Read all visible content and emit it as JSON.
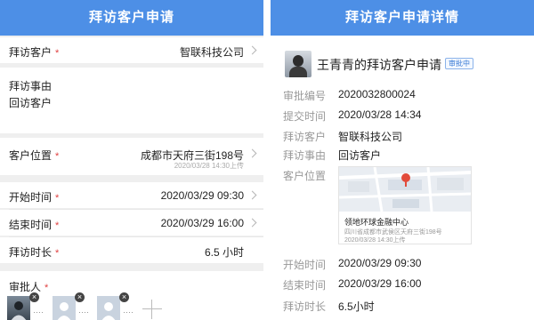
{
  "left": {
    "title": "拜访客户申请",
    "customer": {
      "label": "拜访客户",
      "value": "智联科技公司"
    },
    "matter": {
      "label": "拜访事由",
      "value": "回访客户"
    },
    "location": {
      "label": "客户位置",
      "value": "成都市天府三街198号",
      "sub": "2020/03/28 14:30上传"
    },
    "start": {
      "label": "开始时间",
      "value": "2020/03/29 09:30"
    },
    "end": {
      "label": "结束时间",
      "value": "2020/03/29 16:00"
    },
    "duration": {
      "label": "拜访时长",
      "value": "6.5 小时"
    },
    "approvers_label": "审批人",
    "required_mark": "*",
    "close_mark": "×",
    "dots": "····"
  },
  "right": {
    "title": "拜访客户申请详情",
    "request_title": "王青青的拜访客户申请",
    "badge": "审批中",
    "fields": [
      {
        "label": "审批编号",
        "value": "2020032800024"
      },
      {
        "label": "提交时间",
        "value": "2020/03/28 14:34"
      },
      {
        "label": "拜访客户",
        "value": "智联科技公司"
      },
      {
        "label": "拜访事由",
        "value": "回访客户"
      },
      {
        "label": "客户位置",
        "value": ""
      },
      {
        "label": "开始时间",
        "value": "2020/03/29 09:30"
      },
      {
        "label": "结束时间",
        "value": "2020/03/29 16:00"
      },
      {
        "label": "拜访时长",
        "value": "6.5小时"
      }
    ],
    "map": {
      "place": "领地环球金融中心",
      "address": "四川省成都市武侯区天府三街198号",
      "time": "2020/03/28 14:30上传"
    }
  }
}
